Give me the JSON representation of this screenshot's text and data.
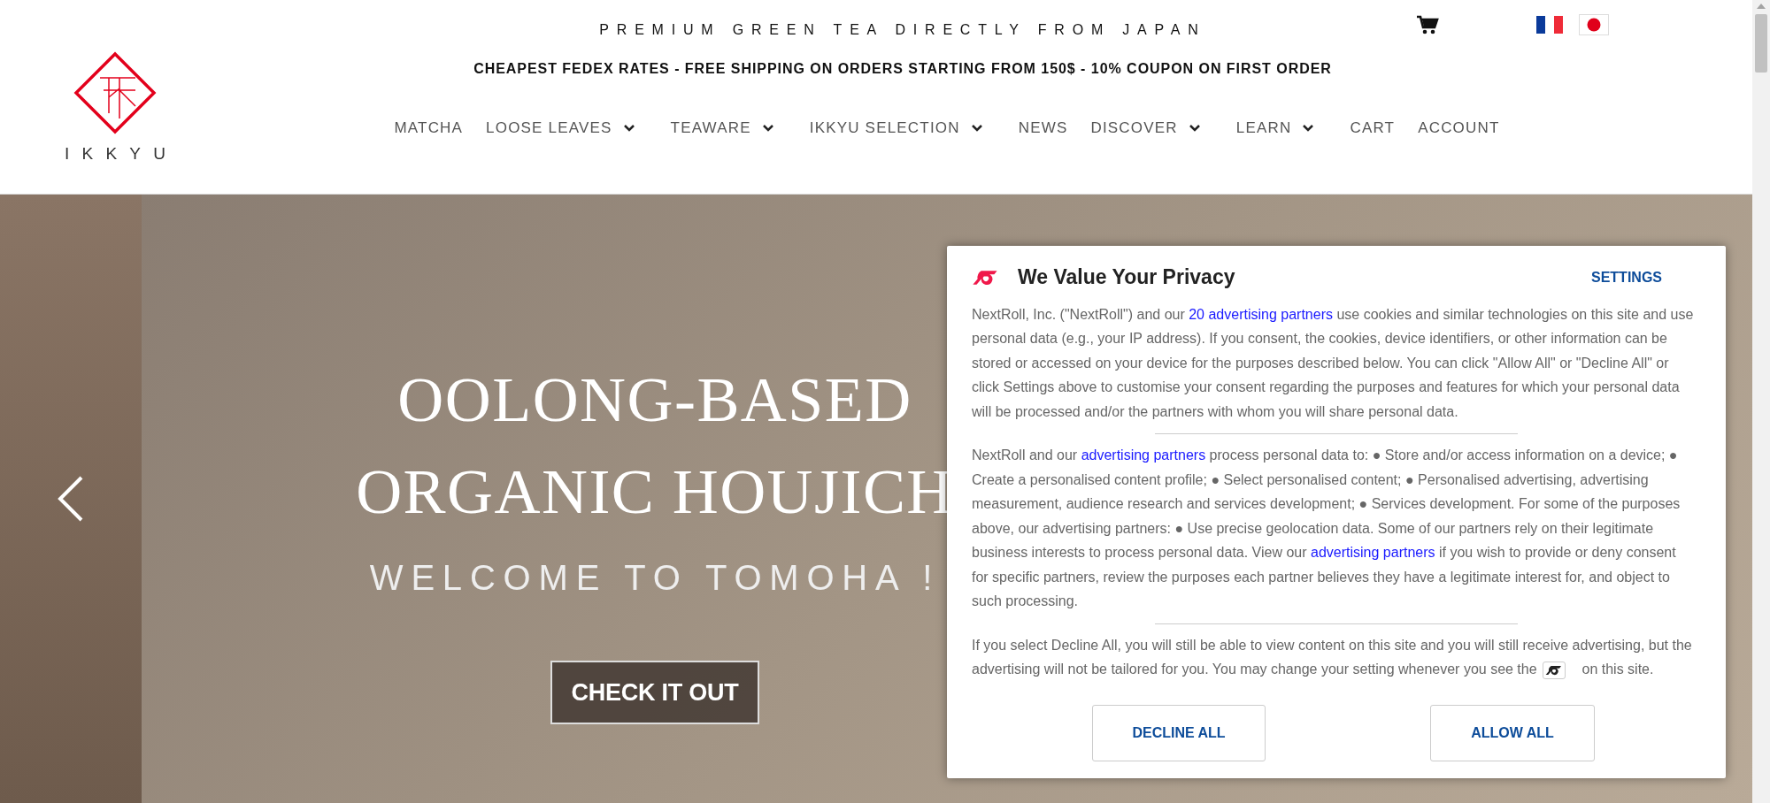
{
  "header": {
    "tagline": "PREMIUM GREEN TEA DIRECTLY FROM JAPAN",
    "shipping_banner": "CHEAPEST FEDEX RATES - FREE SHIPPING ON ORDERS STARTING FROM 150$ - 10% COUPON ON FIRST ORDER",
    "logo_text": "IKKYU",
    "nav": [
      {
        "label": "MATCHA",
        "dropdown": false
      },
      {
        "label": "LOOSE LEAVES",
        "dropdown": true
      },
      {
        "label": "TEAWARE",
        "dropdown": true
      },
      {
        "label": "IKKYU SELECTION",
        "dropdown": true
      },
      {
        "label": "NEWS",
        "dropdown": false
      },
      {
        "label": "DISCOVER",
        "dropdown": true
      },
      {
        "label": "LEARN",
        "dropdown": true
      },
      {
        "label": "CART",
        "dropdown": false
      },
      {
        "label": "ACCOUNT",
        "dropdown": false
      }
    ]
  },
  "hero": {
    "title_lines": [
      "OOLONG-BASED",
      "ORGANIC HOUJICH"
    ],
    "subtitle": "WELCOME TO TOMOHA !",
    "button": "CHECK IT OUT"
  },
  "privacy_dialog": {
    "title": "We Value Your Privacy",
    "settings": "SETTINGS",
    "paragraphs": [
      [
        {
          "kind": "text",
          "text": "NextRoll, Inc. (\"NextRoll\") and our "
        },
        {
          "kind": "link",
          "text": "20 advertising partners"
        },
        {
          "kind": "text",
          "text": " use cookies and similar technologies on this site and use personal data (e.g., your IP address). If you consent, the cookies, device identifiers, or other information can be stored or accessed on your device for the purposes described below. You can click \"Allow All\" or \"Decline All\" or click Settings above to customise your consent regarding the purposes and features for which your personal data will be processed and/or the partners with whom you will share personal data."
        }
      ],
      [
        {
          "kind": "text",
          "text": "NextRoll and our "
        },
        {
          "kind": "link",
          "text": "advertising partners"
        },
        {
          "kind": "text",
          "text": " process personal data to: ● Store and/or access information on a device; ● Create a personalised content profile; ● Select personalised content; ● Personalised advertising, advertising measurement, audience research and services development; ● Services development. For some of the purposes above, our advertising partners: ● Use precise geolocation data. Some of our partners rely on their legitimate business interests to process personal data. View our "
        },
        {
          "kind": "link",
          "text": "advertising partners"
        },
        {
          "kind": "text",
          "text": " if you wish to provide or deny consent for specific partners, review the purposes each partner believes they have a legitimate interest for, and object to such processing."
        }
      ],
      [
        {
          "kind": "text",
          "text": "If you select Decline All, you will still be able to view content on this site and you will still receive advertising, but the advertising will not be tailored for you. You may change your setting whenever you see the "
        },
        {
          "kind": "icon"
        },
        {
          "kind": "text",
          "text": " on this site."
        }
      ]
    ],
    "buttons": [
      "DECLINE ALL",
      "ALLOW ALL"
    ]
  }
}
